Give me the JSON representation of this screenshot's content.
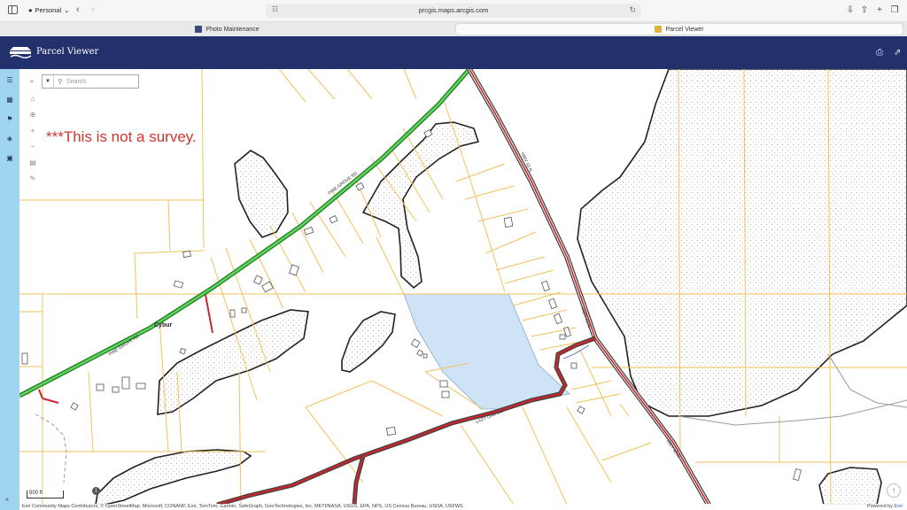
{
  "browser": {
    "profile_label": "Personal",
    "url": "prcgis.maps.arcgis.com",
    "tabs": [
      {
        "label": "Photo Maintenance"
      },
      {
        "label": "Parcel Viewer"
      }
    ]
  },
  "app": {
    "title": "Parcel Viewer",
    "brand_color": "#22306b",
    "rail_color": "#9fd5ef"
  },
  "map": {
    "search_placeholder": "Search",
    "disclaimer": "***This is not a survey.",
    "scale_label": "500 ft",
    "attribution": "Esri Community Maps Contributors, © OpenStreetMap, Microsoft, CONANP, Esri, TomTom, Garmin, SafeGraph, GeoTechnologies, Inc, METI/NASA, USGS, EPA, NPS, US Census Bureau, USDA, USFWS",
    "powered_by": "Powered by",
    "powered_brand": "Esri",
    "labels": {
      "pine_grove_upper": "PINE GROVE RD",
      "pine_grove_lower": "PINE GROVE RD",
      "hwy_upper": "HWY 43 N",
      "hwy_mid": "HWY 43 N",
      "hwy_lower": "HWY 43 N",
      "lazy_oak": "LAZY OAK LN",
      "place": "Cybur"
    },
    "colors": {
      "parcel_line": "#f2c15a",
      "selected_parcel": "#cfe3f7",
      "wetland_outline": "#222222",
      "highway": "#c8262e",
      "pine_grove": "#3dbb3d"
    }
  }
}
